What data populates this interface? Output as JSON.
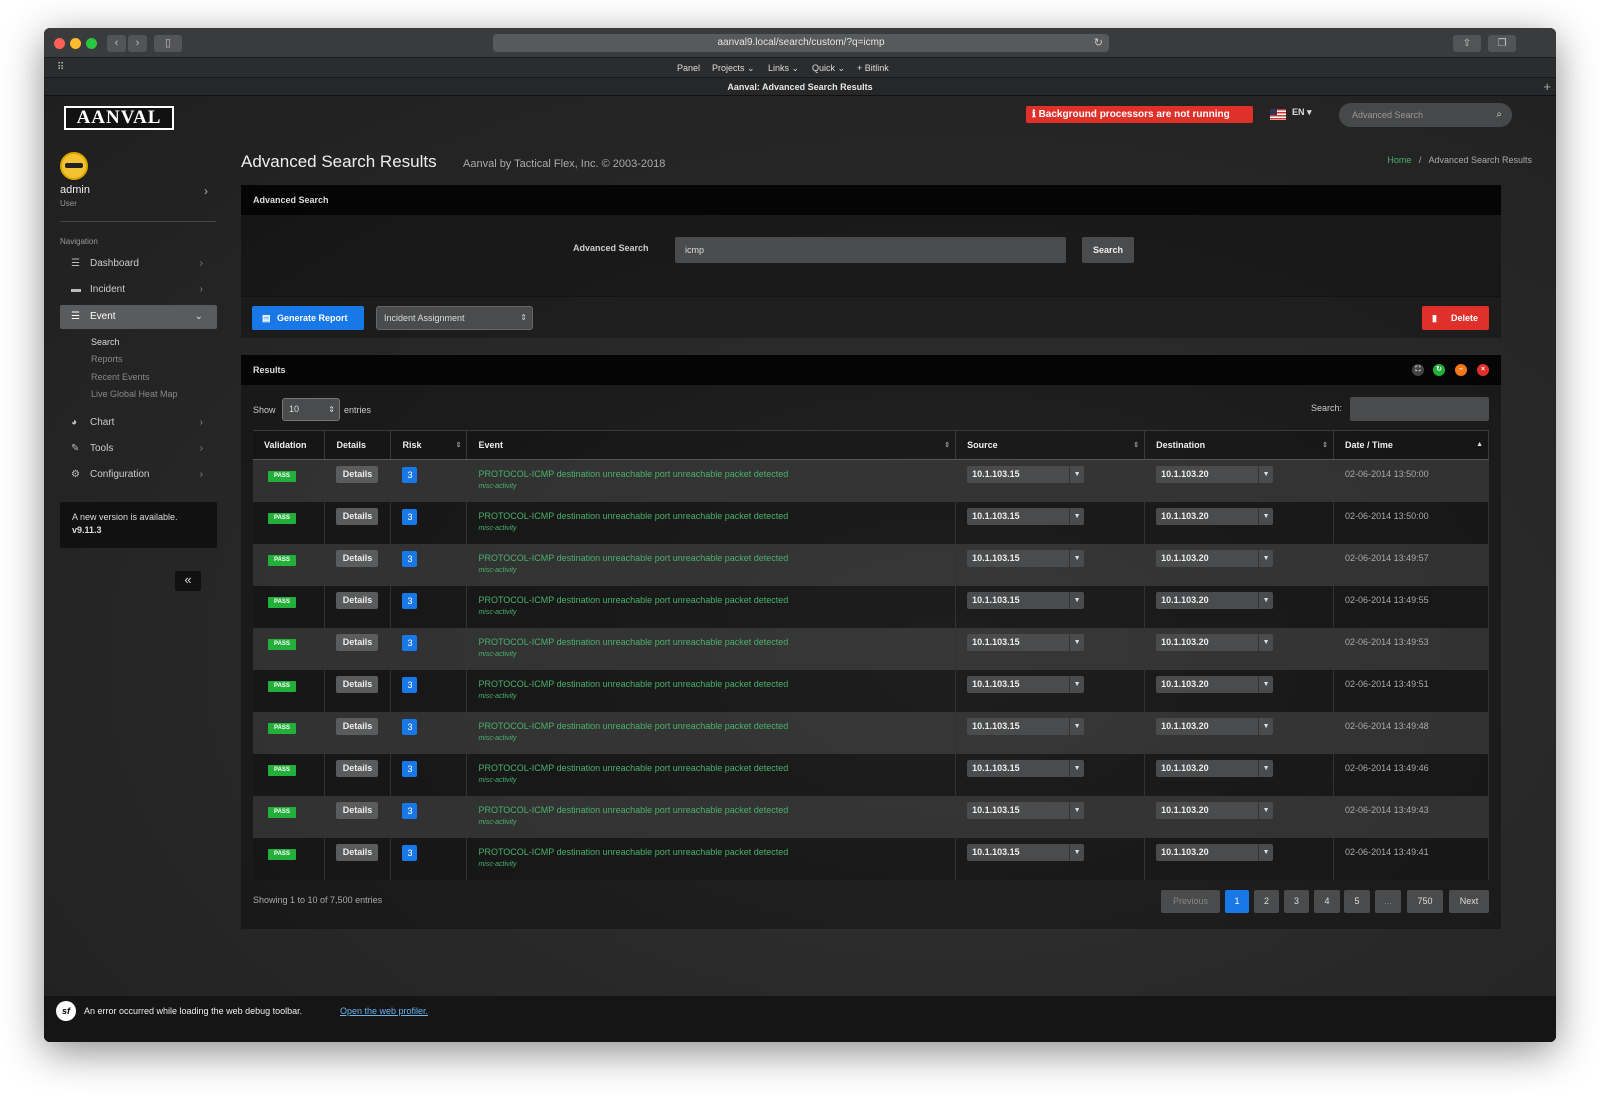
{
  "browser": {
    "url": "aanval9.local/search/custom/?q=icmp",
    "tab_title": "Aanval: Advanced Search Results",
    "bookmarks": [
      "Panel",
      "Projects ⌄",
      "Links ⌄",
      "Quick ⌄",
      "+ Bitlink"
    ]
  },
  "header": {
    "logo": "AANVAL",
    "alert": "Background processors are not running",
    "language": "EN",
    "search_placeholder": "Advanced Search"
  },
  "user": {
    "name": "admin",
    "role": "User"
  },
  "sidebar": {
    "nav_header": "Navigation",
    "items": [
      {
        "label": "Dashboard",
        "icon": "list-icon"
      },
      {
        "label": "Incident",
        "icon": "folder-icon"
      },
      {
        "label": "Event",
        "icon": "list-icon",
        "active": true
      },
      {
        "label": "Chart",
        "icon": "pie-chart-icon"
      },
      {
        "label": "Tools",
        "icon": "wrench-icon"
      },
      {
        "label": "Configuration",
        "icon": "gears-icon"
      }
    ],
    "event_sub": [
      "Search",
      "Reports",
      "Recent Events",
      "Live Global Heat Map"
    ],
    "new_version_line1": "A new version is available.",
    "new_version_line2": "v9.11.3"
  },
  "page": {
    "title": "Advanced Search Results",
    "subtitle": "Aanval by Tactical Flex, Inc. © 2003-2018",
    "breadcrumb_home": "Home",
    "breadcrumb_sep": "/",
    "breadcrumb_current": "Advanced Search Results"
  },
  "advanced_search": {
    "panel_title": "Advanced Search",
    "label": "Advanced Search",
    "value": "icmp",
    "button": "Search"
  },
  "actions": {
    "generate_report": "Generate Report",
    "incident_assignment": "Incident Assignment",
    "delete": "Delete"
  },
  "results": {
    "panel_title": "Results",
    "show_label": "Show",
    "show_value": "10",
    "entries_label": "entries",
    "search_label": "Search:",
    "columns": [
      "Validation",
      "Details",
      "Risk",
      "Event",
      "Source",
      "Destination",
      "Date / Time"
    ],
    "rows": [
      {
        "validation": "PASS",
        "details": "Details",
        "risk": "3",
        "event": "PROTOCOL-ICMP destination unreachable port unreachable packet detected",
        "category": "misc-activity",
        "source": "10.1.103.15",
        "destination": "10.1.103.20",
        "datetime": "02-06-2014 13:50:00"
      },
      {
        "validation": "PASS",
        "details": "Details",
        "risk": "3",
        "event": "PROTOCOL-ICMP destination unreachable port unreachable packet detected",
        "category": "misc-activity",
        "source": "10.1.103.15",
        "destination": "10.1.103.20",
        "datetime": "02-06-2014 13:50:00"
      },
      {
        "validation": "PASS",
        "details": "Details",
        "risk": "3",
        "event": "PROTOCOL-ICMP destination unreachable port unreachable packet detected",
        "category": "misc-activity",
        "source": "10.1.103.15",
        "destination": "10.1.103.20",
        "datetime": "02-06-2014 13:49:57"
      },
      {
        "validation": "PASS",
        "details": "Details",
        "risk": "3",
        "event": "PROTOCOL-ICMP destination unreachable port unreachable packet detected",
        "category": "misc-activity",
        "source": "10.1.103.15",
        "destination": "10.1.103.20",
        "datetime": "02-06-2014 13:49:55"
      },
      {
        "validation": "PASS",
        "details": "Details",
        "risk": "3",
        "event": "PROTOCOL-ICMP destination unreachable port unreachable packet detected",
        "category": "misc-activity",
        "source": "10.1.103.15",
        "destination": "10.1.103.20",
        "datetime": "02-06-2014 13:49:53"
      },
      {
        "validation": "PASS",
        "details": "Details",
        "risk": "3",
        "event": "PROTOCOL-ICMP destination unreachable port unreachable packet detected",
        "category": "misc-activity",
        "source": "10.1.103.15",
        "destination": "10.1.103.20",
        "datetime": "02-06-2014 13:49:51"
      },
      {
        "validation": "PASS",
        "details": "Details",
        "risk": "3",
        "event": "PROTOCOL-ICMP destination unreachable port unreachable packet detected",
        "category": "misc-activity",
        "source": "10.1.103.15",
        "destination": "10.1.103.20",
        "datetime": "02-06-2014 13:49:48"
      },
      {
        "validation": "PASS",
        "details": "Details",
        "risk": "3",
        "event": "PROTOCOL-ICMP destination unreachable port unreachable packet detected",
        "category": "misc-activity",
        "source": "10.1.103.15",
        "destination": "10.1.103.20",
        "datetime": "02-06-2014 13:49:46"
      },
      {
        "validation": "PASS",
        "details": "Details",
        "risk": "3",
        "event": "PROTOCOL-ICMP destination unreachable port unreachable packet detected",
        "category": "misc-activity",
        "source": "10.1.103.15",
        "destination": "10.1.103.20",
        "datetime": "02-06-2014 13:49:43"
      },
      {
        "validation": "PASS",
        "details": "Details",
        "risk": "3",
        "event": "PROTOCOL-ICMP destination unreachable port unreachable packet detected",
        "category": "misc-activity",
        "source": "10.1.103.15",
        "destination": "10.1.103.20",
        "datetime": "02-06-2014 13:49:41"
      }
    ],
    "showing": "Showing 1 to 10 of 7,500 entries",
    "pagination": [
      "Previous",
      "1",
      "2",
      "3",
      "4",
      "5",
      "...",
      "750",
      "Next"
    ]
  },
  "debug": {
    "logo": "sf",
    "message": "An error occurred while loading the web debug toolbar.",
    "link": "Open the web profiler."
  },
  "colors": {
    "accent_blue": "#1878e8",
    "danger_red": "#e0302a",
    "success_green": "#22b03a",
    "event_green": "#4ab06b"
  }
}
